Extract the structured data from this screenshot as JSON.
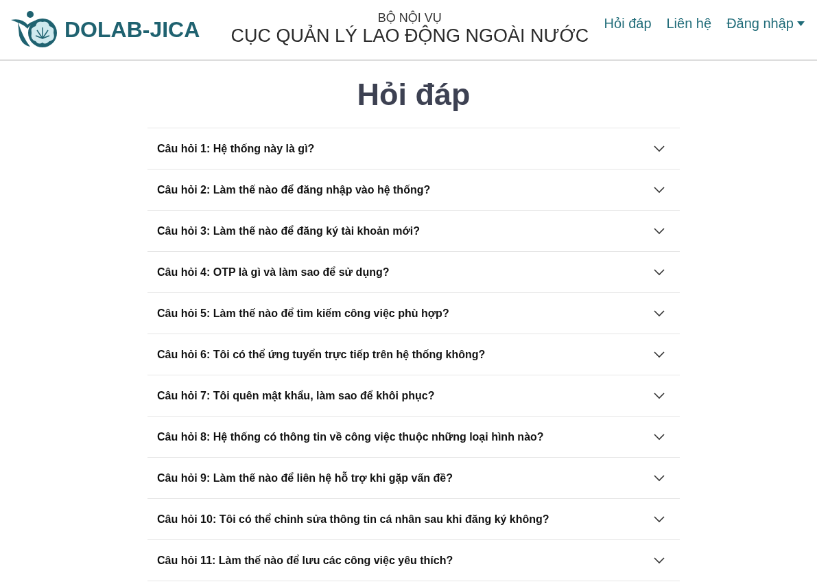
{
  "header": {
    "brand": "DOLAB-JICA",
    "ministry": "BỘ NỘI VỤ",
    "agency": "CỤC QUẢN LÝ LAO ĐỘNG NGOÀI NƯỚC",
    "nav": [
      {
        "label": "Hỏi đáp",
        "kind": "link"
      },
      {
        "label": "Liên hệ",
        "kind": "link"
      },
      {
        "label": "Đăng nhập",
        "kind": "dropdown"
      }
    ]
  },
  "page": {
    "title": "Hỏi đáp"
  },
  "faq": [
    {
      "question": "Câu hỏi 1: Hệ thống này là gì?",
      "expanded": false
    },
    {
      "question": "Câu hỏi 2: Làm thế nào để đăng nhập vào hệ thống?",
      "expanded": false
    },
    {
      "question": "Câu hỏi 3: Làm thế nào để đăng ký tài khoản mới?",
      "expanded": false
    },
    {
      "question": "Câu hỏi 4: OTP là gì và làm sao để sử dụng?",
      "expanded": false
    },
    {
      "question": "Câu hỏi 5: Làm thế nào để tìm kiếm công việc phù hợp?",
      "expanded": false
    },
    {
      "question": "Câu hỏi 6: Tôi có thể ứng tuyển trực tiếp trên hệ thống không?",
      "expanded": false
    },
    {
      "question": "Câu hỏi 7: Tôi quên mật khẩu, làm sao để khôi phục?",
      "expanded": false
    },
    {
      "question": "Câu hỏi 8: Hệ thống có thông tin về công việc thuộc những loại hình nào?",
      "expanded": false
    },
    {
      "question": "Câu hỏi 9: Làm thế nào để liên hệ hỗ trợ khi gặp vấn đề?",
      "expanded": false
    },
    {
      "question": "Câu hỏi 10: Tôi có thể chỉnh sửa thông tin cá nhân sau khi đăng ký không?",
      "expanded": false
    },
    {
      "question": "Câu hỏi 11: Làm thế nào để lưu các công việc yêu thích?",
      "expanded": false
    }
  ]
}
